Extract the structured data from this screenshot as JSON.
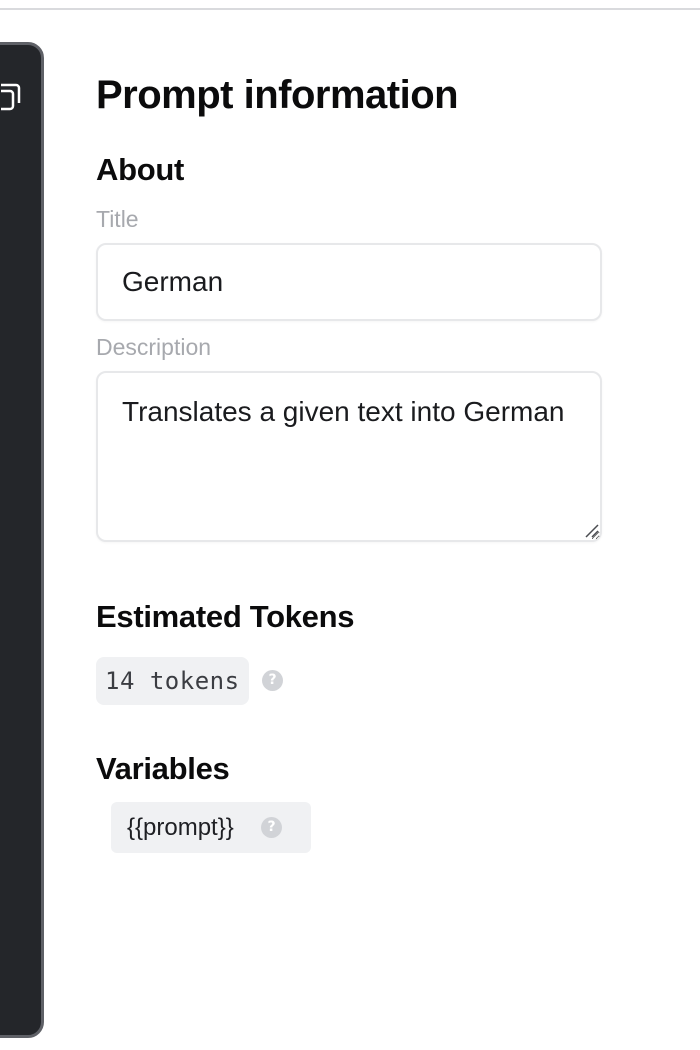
{
  "page": {
    "title": "Prompt information"
  },
  "about": {
    "heading": "About",
    "title_label": "Title",
    "title_value": "German",
    "description_label": "Description",
    "description_value": "Translates a given text into German"
  },
  "tokens": {
    "heading": "Estimated Tokens",
    "badge": "14 tokens",
    "help_icon": "?"
  },
  "variables": {
    "heading": "Variables",
    "items": [
      {
        "label": "{{prompt}}",
        "help_icon": "?"
      }
    ]
  },
  "icons": {
    "panel_icon": "copy-icon",
    "help": "question-circle-icon",
    "resize": "resize-grip-icon"
  },
  "colors": {
    "panel_bg": "#24262a",
    "panel_border": "#5f6167",
    "label_gray": "#a7a9ae",
    "chip_bg": "#f0f1f3"
  }
}
